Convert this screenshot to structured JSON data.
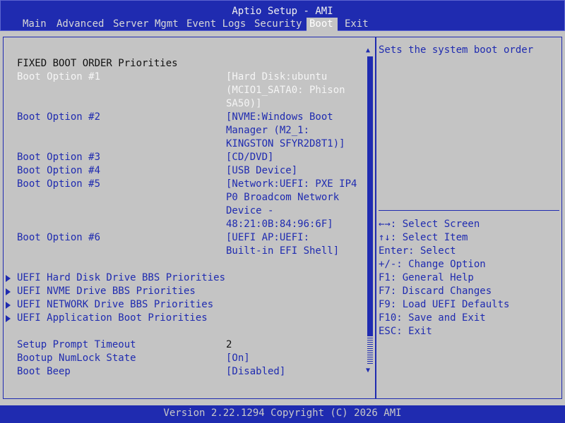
{
  "title": "Aptio Setup - AMI",
  "tabs": [
    "Main",
    "Advanced",
    "Server Mgmt",
    "Event Logs",
    "Security",
    "Boot",
    "Exit"
  ],
  "active_tab": "Boot",
  "section_heading": "FIXED BOOT ORDER Priorities",
  "boot_options": [
    {
      "label": "Boot Option #1",
      "value_lines": [
        "[Hard Disk:ubuntu",
        "(MCIO1_SATA0: Phison",
        "SA50)]"
      ]
    },
    {
      "label": "Boot Option #2",
      "value_lines": [
        "[NVME:Windows Boot",
        "Manager (M2_1:",
        "KINGSTON SFYR2D8T1)]"
      ]
    },
    {
      "label": "Boot Option #3",
      "value_lines": [
        "[CD/DVD]"
      ]
    },
    {
      "label": "Boot Option #4",
      "value_lines": [
        "[USB Device]"
      ]
    },
    {
      "label": "Boot Option #5",
      "value_lines": [
        "[Network:UEFI: PXE IP4",
        "P0 Broadcom Network",
        "Device -",
        "48:21:0B:84:96:6F]"
      ]
    },
    {
      "label": "Boot Option #6",
      "value_lines": [
        "[UEFI AP:UEFI:",
        "Built-in EFI Shell]"
      ]
    }
  ],
  "submenus": [
    "UEFI Hard Disk Drive BBS Priorities",
    "UEFI NVME Drive BBS Priorities",
    "UEFI NETWORK Drive BBS Priorities",
    "UEFI Application Boot Priorities"
  ],
  "settings": [
    {
      "label": "Setup Prompt Timeout",
      "value": "2"
    },
    {
      "label": "Bootup NumLock State",
      "value": "[On]"
    },
    {
      "label": "Boot Beep",
      "value": "[Disabled]"
    }
  ],
  "help_text": "Sets the system boot order",
  "key_help": [
    "←→: Select Screen",
    "↑↓: Select Item",
    "Enter: Select",
    "+/-: Change Option",
    "F1: General Help",
    "F7: Discard Changes",
    "F9: Load UEFI Defaults",
    "F10: Save and Exit",
    "ESC: Exit"
  ],
  "footer": "Version 2.22.1294 Copyright (C) 2026 AMI",
  "colors": {
    "primary_blue": "#1f2bb0",
    "background_gray": "#c4c4c4"
  }
}
